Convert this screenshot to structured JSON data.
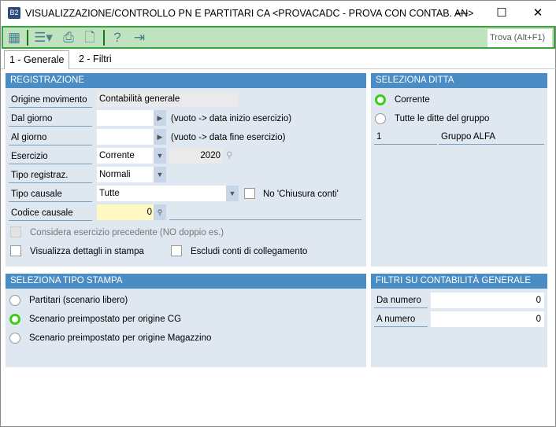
{
  "window": {
    "title": "VISUALIZZAZIONE/CONTROLLO PN E PARTITARI CA <PROVACADC - PROVA CON CONTAB. AN>",
    "app_icon": "B2",
    "minimize": "—",
    "maximize": "☐",
    "close": "✕"
  },
  "toolbar": {
    "find_placeholder": "Trova (Alt+F1)"
  },
  "tabs": [
    {
      "label": "1 - Generale"
    },
    {
      "label": "2 - Filtri"
    }
  ],
  "registrazione": {
    "title": "REGISTRAZIONE",
    "origine_label": "Origine movimento",
    "origine_value": "Contabilità  generale",
    "dal_label": "Dal giorno",
    "dal_value": "",
    "dal_hint": "(vuoto -> data inizio esercizio)",
    "al_label": "Al giorno",
    "al_value": "",
    "al_hint": "(vuoto -> data fine esercizio)",
    "esercizio_label": "Esercizio",
    "esercizio_value": "Corrente",
    "esercizio_year": "2020",
    "tipo_reg_label": "Tipo registraz.",
    "tipo_reg_value": "Normali",
    "tipo_causale_label": "Tipo causale",
    "tipo_causale_value": "Tutte",
    "no_chiusura_label": "No 'Chiusura conti'",
    "codice_causale_label": "Codice causale",
    "codice_causale_value": "0",
    "considera_label": "Considera esercizio precedente (NO doppio es.)",
    "visualizza_label": "Visualizza dettagli in stampa",
    "escludi_label": "Escludi conti di collegamento"
  },
  "ditta": {
    "title": "SELEZIONA DITTA",
    "corrente": "Corrente",
    "tutte": "Tutte le ditte del gruppo",
    "group_code": "1",
    "group_name": "Gruppo ALFA"
  },
  "stampa": {
    "title": "SELEZIONA TIPO STAMPA",
    "options": [
      "Partitari (scenario libero)",
      "Scenario preimpostato per origine CG",
      "Scenario preimpostato per origine Magazzino"
    ]
  },
  "filtri": {
    "title": "FILTRI SU CONTABILITÀ GENERALE",
    "da_label": "Da numero",
    "da_value": "0",
    "a_label": "A numero",
    "a_value": "0"
  }
}
